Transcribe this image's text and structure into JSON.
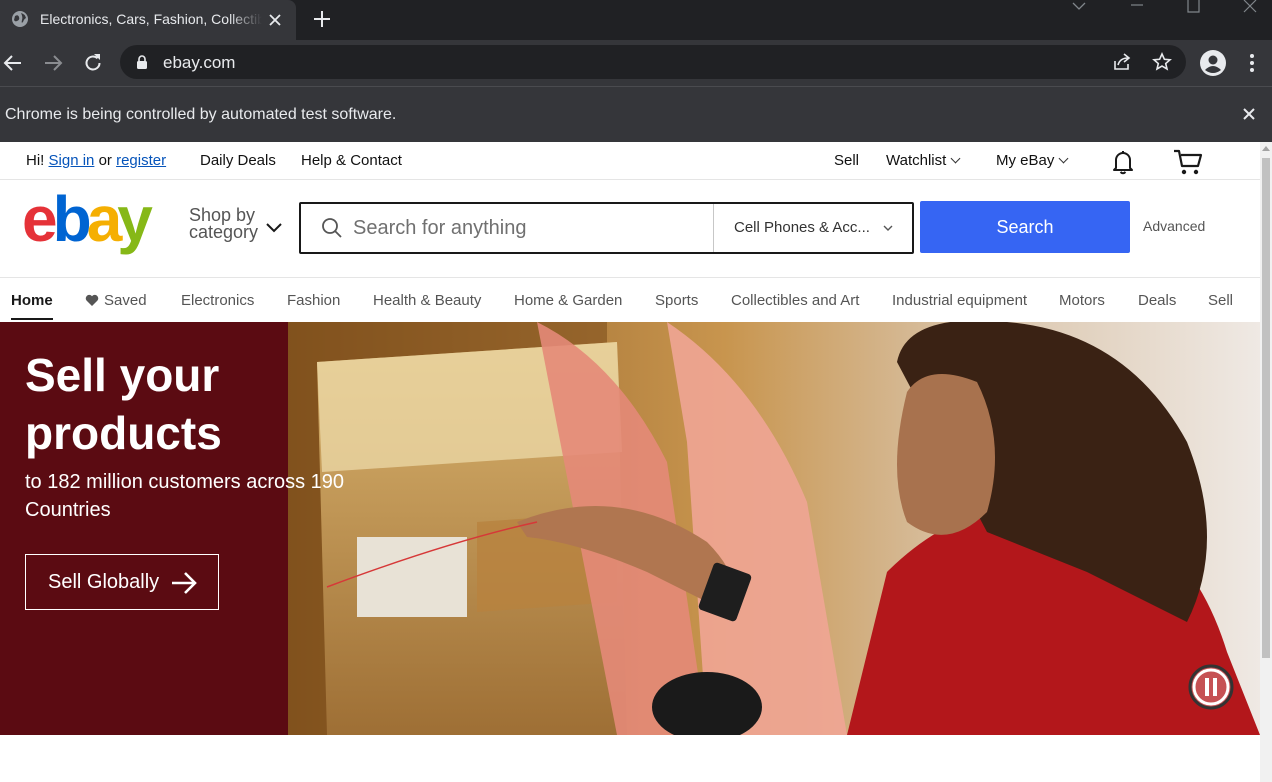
{
  "browser": {
    "tab_title": "Electronics, Cars, Fashion, Collectibles & More | eBay",
    "url": "ebay.com",
    "infobar_text": "Chrome is being controlled by automated test software."
  },
  "topnav": {
    "greeting": "Hi!",
    "sign_in": "Sign in",
    "or": "or",
    "register": "register",
    "daily_deals": "Daily Deals",
    "help_contact": "Help & Contact",
    "sell": "Sell",
    "watchlist": "Watchlist",
    "my_ebay": "My eBay"
  },
  "header": {
    "shop_by_line1": "Shop by",
    "shop_by_line2": "category",
    "search_placeholder": "Search for anything",
    "category_selected": "Cell Phones & Acc...",
    "search_button": "Search",
    "advanced": "Advanced"
  },
  "categories": {
    "home": "Home",
    "saved": "Saved",
    "electronics": "Electronics",
    "fashion": "Fashion",
    "health_beauty": "Health & Beauty",
    "home_garden": "Home & Garden",
    "sports": "Sports",
    "collectibles_art": "Collectibles and Art",
    "industrial": "Industrial equipment",
    "motors": "Motors",
    "deals": "Deals",
    "sell": "Sell"
  },
  "hero": {
    "title": "Sell your products",
    "subtitle": "to 182 million customers across 190 Countries",
    "button": "Sell Globally"
  },
  "colors": {
    "brand_blue": "#3665f3",
    "hero_panel": "#5b0b12",
    "link": "#0654ba",
    "logo_red": "#e53238",
    "logo_blue": "#0064d2",
    "logo_yellow": "#f5af02",
    "logo_green": "#86b817"
  },
  "icons": [
    "globe-icon",
    "close-icon",
    "plus-icon",
    "back-icon",
    "forward-icon",
    "reload-icon",
    "lock-icon",
    "share-icon",
    "star-icon",
    "profile-icon",
    "menu-icon",
    "bell-icon",
    "cart-icon",
    "search-icon",
    "chevron-down-icon",
    "heart-icon",
    "arrow-right-icon",
    "pause-icon"
  ]
}
